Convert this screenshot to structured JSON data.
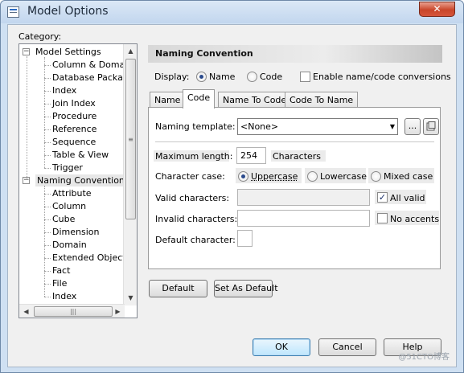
{
  "window": {
    "title": "Model Options",
    "close_label": "✕"
  },
  "category": {
    "label": "Category:",
    "tree": [
      {
        "label": "Model Settings",
        "level": 0,
        "expanded": true
      },
      {
        "label": "Column & Domain",
        "level": 1
      },
      {
        "label": "Database Packag",
        "level": 1
      },
      {
        "label": "Index",
        "level": 1
      },
      {
        "label": "Join Index",
        "level": 1
      },
      {
        "label": "Procedure",
        "level": 1
      },
      {
        "label": "Reference",
        "level": 1
      },
      {
        "label": "Sequence",
        "level": 1
      },
      {
        "label": "Table & View",
        "level": 1
      },
      {
        "label": "Trigger",
        "level": 1
      },
      {
        "label": "Naming Convention",
        "level": 0,
        "expanded": true,
        "selected": true
      },
      {
        "label": "Attribute",
        "level": 1
      },
      {
        "label": "Column",
        "level": 1
      },
      {
        "label": "Cube",
        "level": 1
      },
      {
        "label": "Dimension",
        "level": 1
      },
      {
        "label": "Domain",
        "level": 1
      },
      {
        "label": "Extended Object",
        "level": 1
      },
      {
        "label": "Fact",
        "level": 1
      },
      {
        "label": "File",
        "level": 1
      },
      {
        "label": "Index",
        "level": 1
      }
    ]
  },
  "panel": {
    "title": "Naming Convention",
    "display_label": "Display:",
    "display_options": [
      "Name",
      "Code"
    ],
    "display_selected": "Name",
    "enable_conversions_label": "Enable name/code conversions",
    "enable_conversions_checked": false,
    "tabs": [
      "Name",
      "Code",
      "Name To Code",
      "Code To Name"
    ],
    "active_tab": "Code"
  },
  "form": {
    "naming_template_label": "Naming template:",
    "naming_template_value": "<None>",
    "ellipsis_label": "...",
    "max_length_label": "Maximum length:",
    "max_length_value": "254",
    "max_length_unit": "Characters",
    "character_case_label": "Character case:",
    "case_options": [
      "Uppercase",
      "Lowercase",
      "Mixed case"
    ],
    "case_selected": "Uppercase",
    "valid_chars_label": "Valid characters:",
    "valid_chars_value": "",
    "all_valid_label": "All valid",
    "all_valid_checked": true,
    "invalid_chars_label": "Invalid characters:",
    "invalid_chars_value": "",
    "no_accents_label": "No accents",
    "no_accents_checked": false,
    "default_char_label": "Default character:",
    "default_char_value": ""
  },
  "buttons": {
    "default": "Default",
    "set_as_default": "Set As Default",
    "ok": "OK",
    "cancel": "Cancel",
    "help": "Help"
  },
  "watermark": "@51CTO博客"
}
